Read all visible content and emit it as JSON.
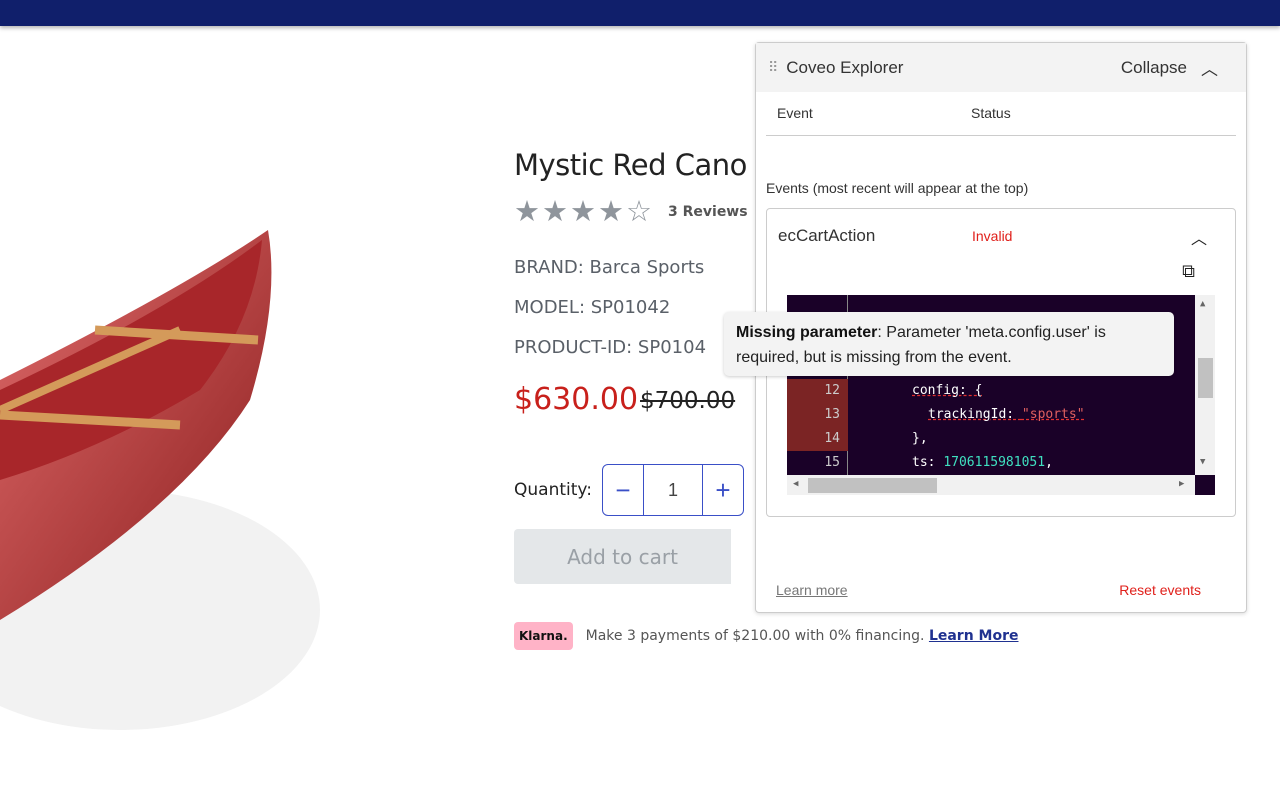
{
  "product": {
    "title": "Mystic Red Cano",
    "rating": 4,
    "rating_max": 5,
    "reviews": "3 Reviews",
    "brand": "BRAND: Barca Sports",
    "model": "MODEL: SP01042",
    "product_id": "PRODUCT-ID: SP0104",
    "price": "$630.00",
    "old_price": "$700.00",
    "quantity_label": "Quantity:",
    "quantity": "1",
    "add_to_cart": "Add to cart"
  },
  "klarna": {
    "logo": "Klarna.",
    "text": "Make 3 payments of $210.00 with 0% financing.",
    "link": "Learn More"
  },
  "explorer": {
    "title": "Coveo Explorer",
    "collapse": "Collapse",
    "col_event": "Event",
    "col_status": "Status",
    "events_label": "Events (most recent will appear at the top)",
    "event": {
      "name": "ecCartAction",
      "status": "Invalid"
    },
    "code": {
      "lines": [
        {
          "n": "12",
          "text": "config: {"
        },
        {
          "n": "13",
          "key": "trackingId: ",
          "str": "\"sports\""
        },
        {
          "n": "14",
          "text": "},"
        },
        {
          "n": "15",
          "key": "ts: ",
          "num": "1706115981051",
          "end": ","
        }
      ]
    },
    "learn_more": "Learn more",
    "reset": "Reset events"
  },
  "tooltip": {
    "title": "Missing parameter",
    "message": ": Parameter 'meta.config.user' is required, but is missing from the event."
  },
  "colors": {
    "topbar": "#101f6b",
    "price": "#c8201b",
    "invalid": "#e0201b",
    "code_bg": "#1a0128"
  }
}
